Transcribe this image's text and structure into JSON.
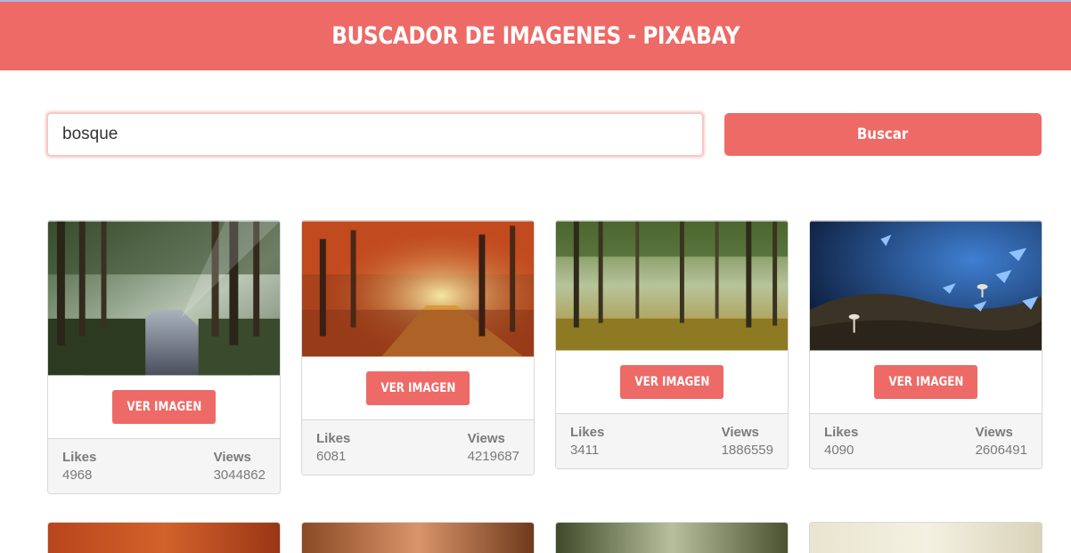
{
  "header": {
    "title": "BUSCADOR DE IMAGENES - PIXABAY"
  },
  "search": {
    "value": "bosque",
    "button_label": "Buscar"
  },
  "colors": {
    "accent": "#ed6a66",
    "footer_bg": "#f5f5f5"
  },
  "cards": [
    {
      "image": "forest-road-sunbeams",
      "button_label": "VER IMAGEN",
      "likes_label": "Likes",
      "likes": "4968",
      "views_label": "Views",
      "views": "3044862"
    },
    {
      "image": "autumn-forest-path",
      "button_label": "VER IMAGEN",
      "likes_label": "Likes",
      "likes": "6081",
      "views_label": "Views",
      "views": "4219687"
    },
    {
      "image": "sunlit-green-forest",
      "button_label": "VER IMAGEN",
      "likes_label": "Likes",
      "likes": "3411",
      "views_label": "Views",
      "views": "1886559"
    },
    {
      "image": "blue-butterflies-mushrooms",
      "button_label": "VER IMAGEN",
      "likes_label": "Likes",
      "likes": "4090",
      "views_label": "Views",
      "views": "2606491"
    }
  ],
  "second_row": [
    {
      "image": "autumn-trees-red"
    },
    {
      "image": "misty-orange-forest"
    },
    {
      "image": "green-forest-light"
    },
    {
      "image": "pale-foggy-forest"
    }
  ]
}
